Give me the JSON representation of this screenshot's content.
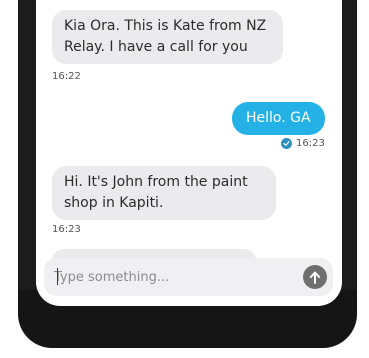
{
  "messages": [
    {
      "direction": "incoming",
      "lines": [
        "Kia Ora. This is Kate from NZ",
        "Relay. I have a call for you"
      ],
      "time": "16:22"
    },
    {
      "direction": "outgoing",
      "text": "Hello. GA",
      "time": "16:23",
      "status_icon": "read-check-icon"
    },
    {
      "direction": "incoming",
      "lines": [
        "Hi. It's John from the paint",
        "shop in Kapiti."
      ],
      "time": "16:23"
    }
  ],
  "composer": {
    "placeholder": "Type something...",
    "send_icon": "arrow-up-icon"
  },
  "colors": {
    "outgoing_bubble": "#24b2e6",
    "incoming_bubble": "#ebebee",
    "read_check": "#2a8fbf",
    "send_button": "#6f6f6f",
    "frame": "#1c1c1c"
  }
}
